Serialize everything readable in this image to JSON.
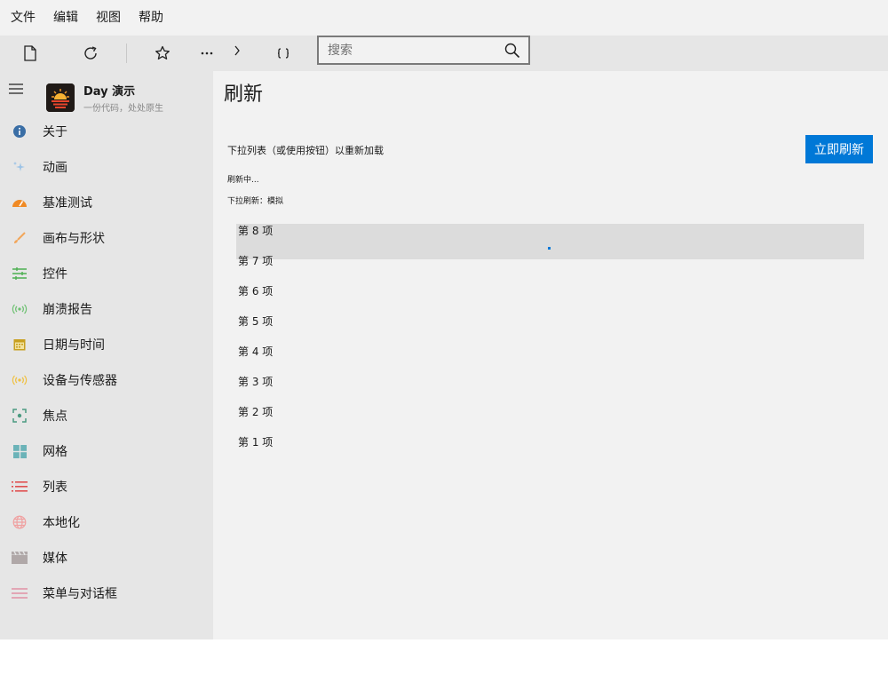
{
  "menu": [
    "文件",
    "编辑",
    "视图",
    "帮助"
  ],
  "toolbar": {
    "icons": [
      "new-document-icon",
      "refresh-icon",
      "star-icon",
      "more-icon",
      "chevron-right-icon",
      "braces-icon"
    ],
    "search": {
      "placeholder": "搜索",
      "value": ""
    }
  },
  "app": {
    "name": "Day 演示",
    "slogan": "一份代码，处处原生"
  },
  "nav": [
    {
      "label": "关于",
      "icon": "info-icon",
      "color": "#3a6ea5"
    },
    {
      "label": "动画",
      "icon": "sparkle-icon",
      "color": "#9cc3e6"
    },
    {
      "label": "基准测试",
      "icon": "gauge-icon",
      "color": "#f08a24"
    },
    {
      "label": "画布与形状",
      "icon": "brush-icon",
      "color": "#f2a65a"
    },
    {
      "label": "控件",
      "icon": "sliders-icon",
      "color": "#4caf50"
    },
    {
      "label": "崩溃报告",
      "icon": "broadcast-icon",
      "color": "#6cc070"
    },
    {
      "label": "日期与时间",
      "icon": "calendar-icon",
      "color": "#c8a020"
    },
    {
      "label": "设备与传感器",
      "icon": "sensor-icon",
      "color": "#f0c040"
    },
    {
      "label": "焦点",
      "icon": "focus-icon",
      "color": "#4a9a80"
    },
    {
      "label": "网格",
      "icon": "grid-icon",
      "color": "#6bb3b8"
    },
    {
      "label": "列表",
      "icon": "list-icon",
      "color": "#e05050"
    },
    {
      "label": "本地化",
      "icon": "globe-icon",
      "color": "#f0a0a0"
    },
    {
      "label": "媒体",
      "icon": "clapper-icon",
      "color": "#b0a8a8"
    },
    {
      "label": "菜单与对话框",
      "icon": "menu-icon",
      "color": "#e08098"
    }
  ],
  "page": {
    "title": "刷新",
    "description": "下拉列表（或使用按钮）以重新加载",
    "refresh_button": "立即刷新",
    "status_refreshing": "刷新中...",
    "status_pull": "下拉刷新：模拟",
    "items": [
      "第 8 项",
      "第 7 项",
      "第 6 项",
      "第 5 项",
      "第 4 项",
      "第 3 项",
      "第 2 项",
      "第 1 项"
    ]
  }
}
